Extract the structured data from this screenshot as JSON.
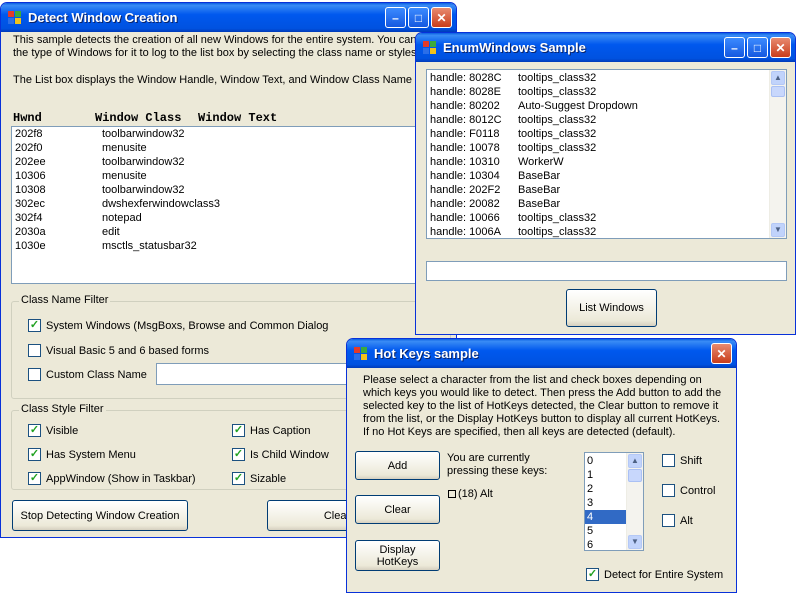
{
  "detect": {
    "title": "Detect Window Creation",
    "desc1": "This sample detects the creation of all new Windows for the entire system. You can",
    "desc2": "the type of Windows for it to log to the list box by selecting the class name or styles",
    "desc3": "The List box displays the Window Handle, Window Text, and Window Class Name",
    "col_hwnd": "Hwnd",
    "col_class": "Window Class",
    "col_text": "Window Text",
    "rows": [
      {
        "hwnd": "202f8",
        "cls": "toolbarwindow32"
      },
      {
        "hwnd": "202f0",
        "cls": "menusite"
      },
      {
        "hwnd": "202ee",
        "cls": "toolbarwindow32"
      },
      {
        "hwnd": "10306",
        "cls": "menusite"
      },
      {
        "hwnd": "10308",
        "cls": "toolbarwindow32"
      },
      {
        "hwnd": "302ec",
        "cls": "dwshexferwindowclass3"
      },
      {
        "hwnd": "302f4",
        "cls": "notepad"
      },
      {
        "hwnd": "2030a",
        "cls": "edit"
      },
      {
        "hwnd": "1030e",
        "cls": "msctls_statusbar32"
      }
    ],
    "class_filter_label": "Class Name Filter",
    "chk_system": "System Windows (MsgBoxs, Browse and Common Dialog",
    "chk_vb": "Visual Basic 5 and 6 based forms",
    "chk_custom": "Custom Class Name",
    "style_filter_label": "Class Style Filter",
    "chk_visible": "Visible",
    "chk_sysmenu": "Has System Menu",
    "chk_appwindow": "AppWindow (Show in Taskbar)",
    "chk_caption": "Has Caption",
    "chk_child": "Is Child Window",
    "chk_sizable": "Sizable",
    "btn_stop": "Stop Detecting Window Creation",
    "btn_clear": "Clear"
  },
  "enum": {
    "title": "EnumWindows Sample",
    "rows": [
      {
        "handle": "handle: 8028C",
        "cls": "tooltips_class32"
      },
      {
        "handle": "handle: 8028E",
        "cls": "tooltips_class32"
      },
      {
        "handle": "handle: 80202",
        "cls": "Auto-Suggest Dropdown"
      },
      {
        "handle": "handle: 8012C",
        "cls": "tooltips_class32"
      },
      {
        "handle": "handle: F0118",
        "cls": "tooltips_class32"
      },
      {
        "handle": "handle: 10078",
        "cls": "tooltips_class32"
      },
      {
        "handle": "handle: 10310",
        "cls": "WorkerW"
      },
      {
        "handle": "handle: 10304",
        "cls": "BaseBar"
      },
      {
        "handle": "handle: 202F2",
        "cls": "BaseBar"
      },
      {
        "handle": "handle: 20082",
        "cls": "BaseBar"
      },
      {
        "handle": "handle: 10066",
        "cls": "tooltips_class32"
      },
      {
        "handle": "handle: 1006A",
        "cls": "tooltips_class32"
      }
    ],
    "btn_list": "List Windows"
  },
  "hotkeys": {
    "title": "Hot Keys sample",
    "instr1": "Please select a character from the list and check boxes depending on",
    "instr2": "which keys you would like to detect.  Then press the Add button to add the",
    "instr3": "selected key to the list of HotKeys detected, the Clear button to remove it",
    "instr4": "from the list, or the Display HotKeys button to display all current HotKeys.",
    "instr5": "If no Hot Keys are specified, then all keys are detected (default).",
    "btn_add": "Add",
    "btn_clear": "Clear",
    "btn_display": "Display HotKeys",
    "pressing1": "You are currently",
    "pressing2": "pressing these keys:",
    "pressed": "(18) Alt",
    "chars": [
      "0",
      "1",
      "2",
      "3",
      "4",
      "5",
      "6"
    ],
    "selected_char": "4",
    "chk_shift": "Shift",
    "chk_control": "Control",
    "chk_alt": "Alt",
    "chk_entire": "Detect for Entire System"
  }
}
